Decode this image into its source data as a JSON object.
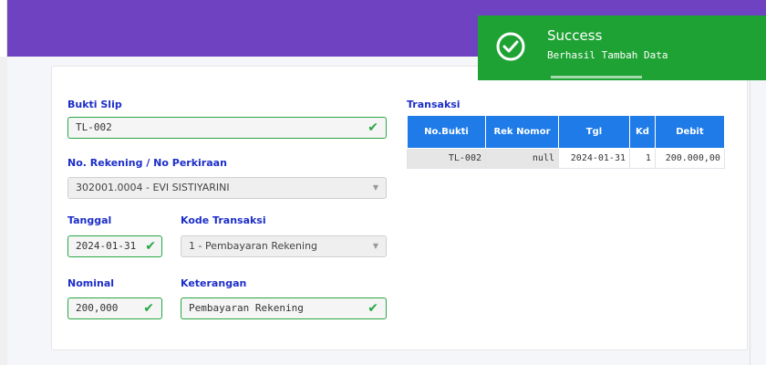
{
  "form": {
    "bukti_slip_label": "Bukti Slip",
    "bukti_slip_value": "TL-002",
    "rekening_label": "No. Rekening / No Perkiraan",
    "rekening_value": "302001.0004 - EVI SISTIYARINI",
    "tanggal_label": "Tanggal",
    "tanggal_value": "2024-01-31",
    "kode_label": "Kode Transaksi",
    "kode_value": "1 - Pembayaran Rekening",
    "nominal_label": "Nominal",
    "nominal_value": "200,000",
    "keterangan_label": "Keterangan",
    "keterangan_value": "Pembayaran Rekening",
    "check_glyph": "✔",
    "caret_glyph": "▼"
  },
  "transaksi": {
    "title": "Transaksi",
    "headers": [
      "No.Bukti",
      "Rek Nomor",
      "Tgl",
      "Kd",
      "Debit"
    ],
    "rows": [
      [
        "TL-002",
        "null",
        "2024-01-31",
        "1",
        "200.000,00"
      ]
    ]
  },
  "toast": {
    "title": "Success",
    "message": "Berhasil Tambah Data",
    "icon": "check-circle-icon"
  },
  "colors": {
    "header": "#6f42c1",
    "toast": "#1fa234",
    "table_header": "#1e7be8",
    "label": "#1c2ec9",
    "valid": "#28a745"
  }
}
